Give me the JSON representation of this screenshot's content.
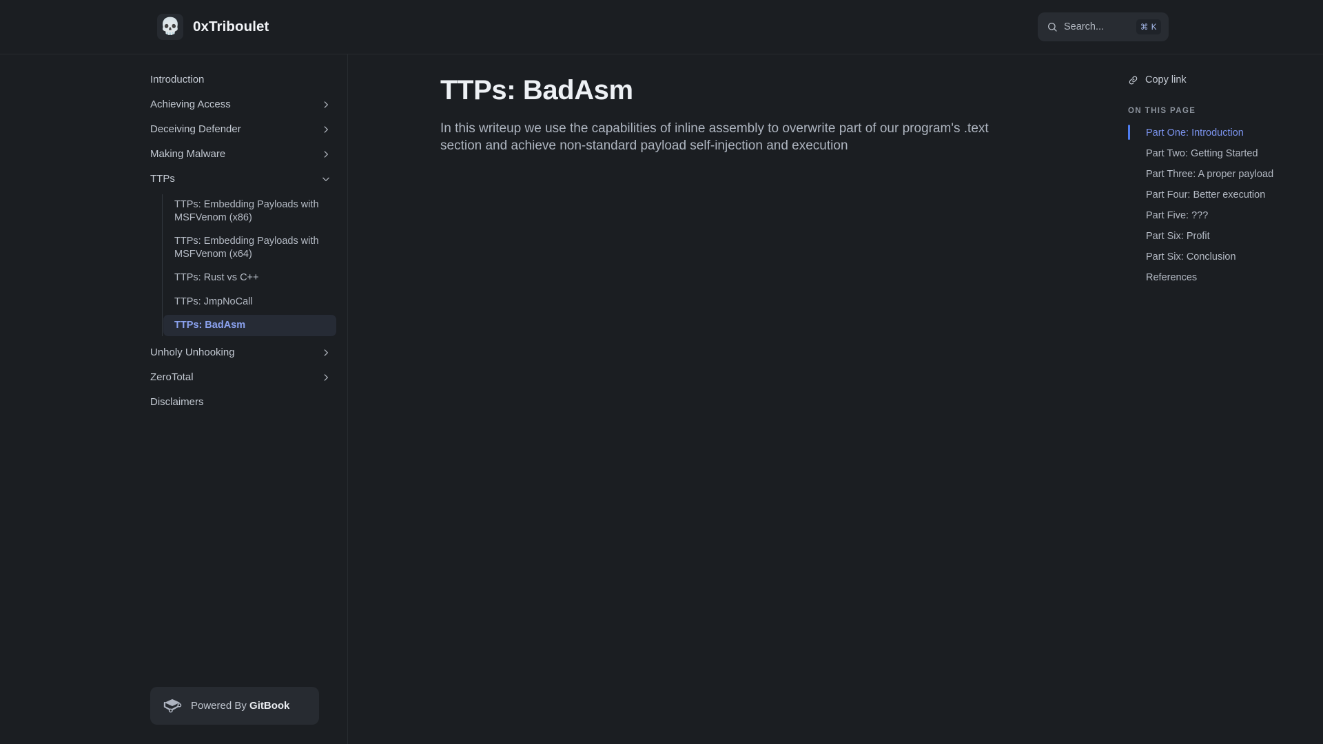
{
  "header": {
    "logo_icon": "skull-emoji",
    "logo_glyph": "💀",
    "title": "0xTriboulet",
    "search": {
      "icon": "search-icon",
      "placeholder": "Search...",
      "shortcut": "⌘ K"
    }
  },
  "sidebar": {
    "items": [
      {
        "label": "Introduction",
        "chevron": "none"
      },
      {
        "label": "Achieving Access",
        "chevron": "right"
      },
      {
        "label": "Deceiving Defender",
        "chevron": "right"
      },
      {
        "label": "Making Malware",
        "chevron": "right"
      },
      {
        "label": "TTPs",
        "chevron": "down"
      }
    ],
    "sub_items": [
      {
        "label": "TTPs: Embedding Payloads with MSFVenom (x86)",
        "active": false
      },
      {
        "label": "TTPs: Embedding Payloads with MSFVenom (x64)",
        "active": false
      },
      {
        "label": "TTPs: Rust vs C++",
        "active": false
      },
      {
        "label": "TTPs: JmpNoCall",
        "active": false
      },
      {
        "label": "TTPs: BadAsm",
        "active": true
      }
    ],
    "items_after": [
      {
        "label": "Unholy Unhooking",
        "chevron": "right"
      },
      {
        "label": "ZeroTotal",
        "chevron": "right"
      },
      {
        "label": "Disclaimers",
        "chevron": "none"
      }
    ],
    "footer": {
      "icon": "gitbook-book-icon",
      "prefix": "Powered By ",
      "brand": "GitBook"
    }
  },
  "main": {
    "title": "TTPs: BadAsm",
    "description": "In this writeup we use the capabilities of inline assembly to overwrite part of our program's .text section and achieve non-standard payload self-injection and execution"
  },
  "rail": {
    "copy_link": {
      "icon": "link-icon",
      "label": "Copy link"
    },
    "heading": "ON THIS PAGE",
    "toc": [
      {
        "label": "Part One: Introduction",
        "active": true
      },
      {
        "label": "Part Two: Getting Started",
        "active": false
      },
      {
        "label": "Part Three: A proper payload",
        "active": false
      },
      {
        "label": "Part Four: Better execution",
        "active": false
      },
      {
        "label": "Part Five: ???",
        "active": false
      },
      {
        "label": "Part Six: Profit",
        "active": false
      },
      {
        "label": "Part Six: Conclusion",
        "active": false
      },
      {
        "label": "References",
        "active": false
      }
    ]
  },
  "colors": {
    "page_bg": "#1b1e22",
    "border": "#272b30",
    "accent_blue": "#4e7df0",
    "active_text": "#8ba2ef",
    "muted_text": "#b4bac4"
  }
}
